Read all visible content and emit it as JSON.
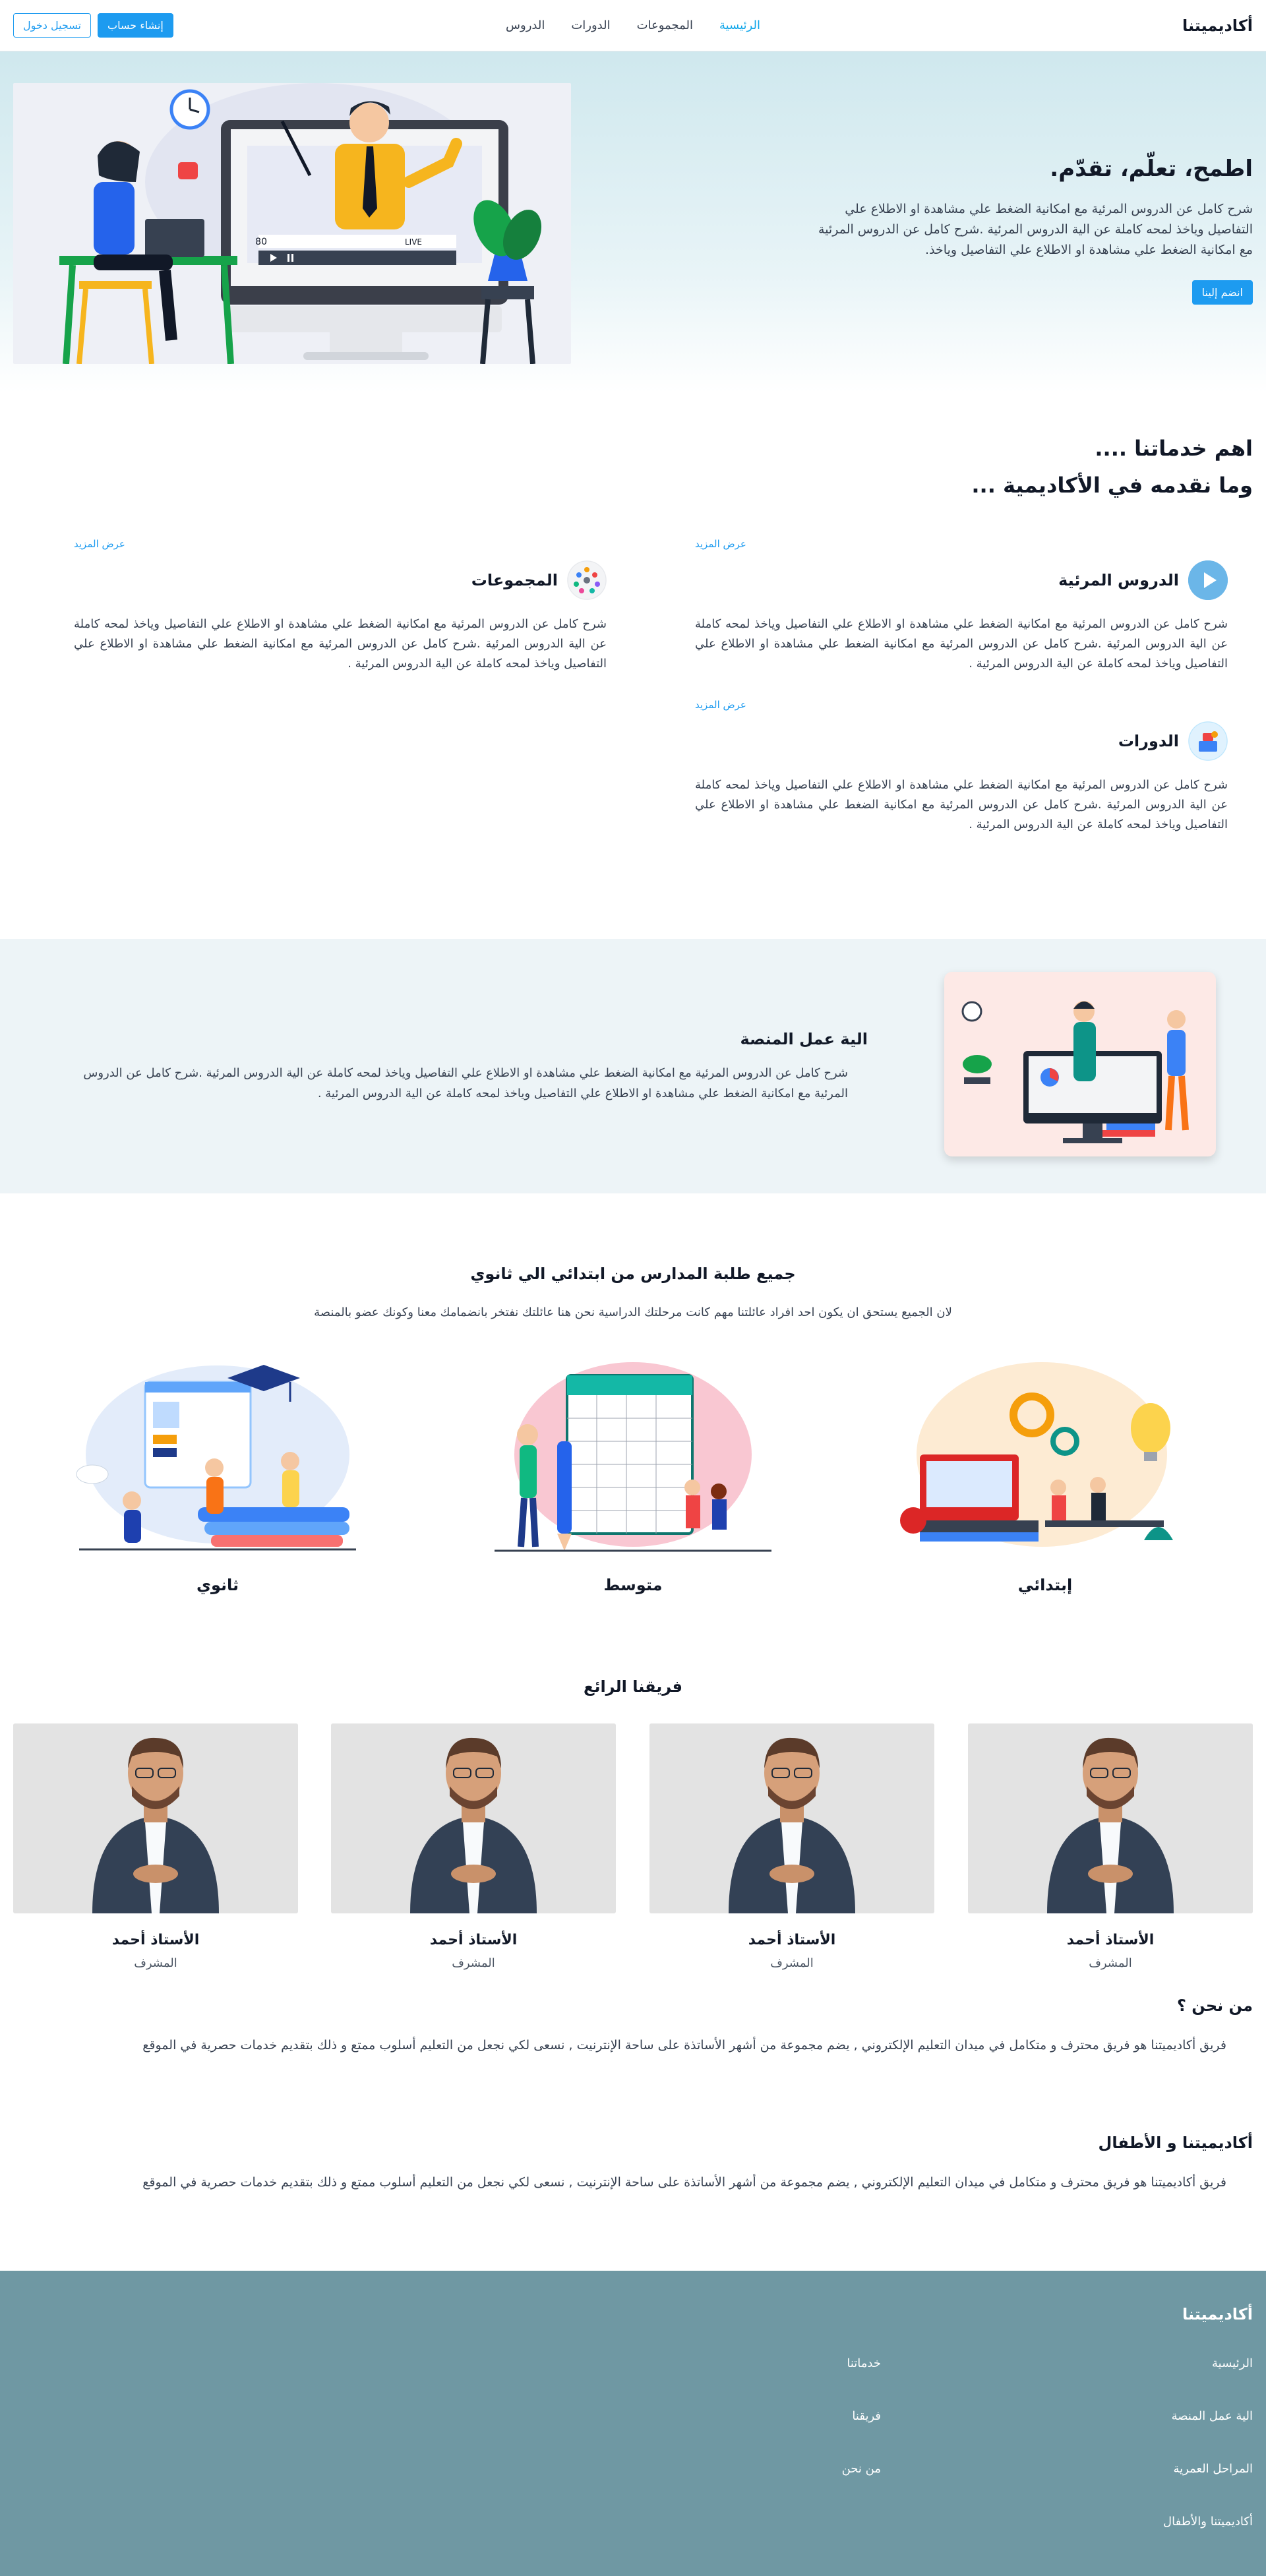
{
  "nav": {
    "brand": "أكاديميتنا",
    "links": [
      "الرئيسية",
      "المجموعات",
      "الدورات",
      "الدروس"
    ],
    "signup_label": "إنشاء حساب",
    "login_label": "تسجيل دخول"
  },
  "hero": {
    "title": "اطمح، تعلّم، تقدّم.",
    "description": "شرح كامل عن الدروس المرئية مع امكانية الضغط علي مشاهدة او الاطلاع علي التفاصيل وياخذ لمحه كاملة عن الية الدروس المرئية .شرح كامل عن الدروس المرئية مع امكانية الضغط علي مشاهدة او الاطلاع علي التفاصيل وياخذ.",
    "join_label": "انضم إلينا",
    "video_viewers": "80",
    "live_label": "LIVE"
  },
  "services": {
    "heading_line1": "اهم خدماتنا ....",
    "heading_line2": "وما نقدمه في الأكاديمية ...",
    "items": [
      {
        "title": "الدروس المرئية",
        "more": "عرض المزيد",
        "icon": "play-icon",
        "description": "شرح كامل عن الدروس المرئية مع امكانية الضغط علي مشاهدة او الاطلاع علي التفاصيل وياخذ لمحه كاملة عن الية الدروس المرئية .شرح كامل عن الدروس المرئية مع امكانية الضغط علي مشاهدة او الاطلاع علي التفاصيل وياخذ لمحه كاملة عن الية الدروس المرئية ."
      },
      {
        "title": "المجموعات",
        "more": "عرض المزيد",
        "icon": "group-icon",
        "description": "شرح كامل عن الدروس المرئية مع امكانية الضغط علي مشاهدة او الاطلاع علي التفاصيل وياخذ لمحه كاملة عن الية الدروس المرئية .شرح كامل عن الدروس المرئية مع امكانية الضغط علي مشاهدة او الاطلاع علي التفاصيل وياخذ لمحه كاملة عن الية الدروس المرئية ."
      },
      {
        "title": "الدورات",
        "more": "عرض المزيد",
        "icon": "courses-icon",
        "description": "شرح كامل عن الدروس المرئية مع امكانية الضغط علي مشاهدة او الاطلاع علي التفاصيل وياخذ لمحه كاملة عن الية الدروس المرئية .شرح كامل عن الدروس المرئية مع امكانية الضغط علي مشاهدة او الاطلاع علي التفاصيل وياخذ لمحه كاملة عن الية الدروس المرئية ."
      }
    ]
  },
  "platform": {
    "title": "الية عمل المنصة",
    "description": "شرح كامل عن الدروس المرئية مع امكانية الضغط علي مشاهدة او الاطلاع علي التفاصيل وياخذ لمحه كاملة عن الية الدروس المرئية .شرح كامل عن الدروس المرئية مع امكانية الضغط علي مشاهدة او الاطلاع علي التفاصيل وياخذ لمحه كاملة عن الية الدروس المرئية ."
  },
  "stages": {
    "title": "جميع طلبة المدارس من ابتدائي الي ثانوي",
    "subtitle": "لان الجميع يستحق ان يكون احد افراد عائلتنا مهم كانت مرحلتك الدراسية نحن هنا عائلتك نفتخر بانضمامك معنا وكونك عضو بالمنصة",
    "items": [
      "إبتدائي",
      "متوسط",
      "ثانوي"
    ]
  },
  "team": {
    "title": "فريقنا الرائع",
    "members": [
      {
        "name": "الأستاذ أحمد",
        "role": "المشرف"
      },
      {
        "name": "الأستاذ أحمد",
        "role": "المشرف"
      },
      {
        "name": "الأستاذ أحمد",
        "role": "المشرف"
      },
      {
        "name": "الأستاذ أحمد",
        "role": "المشرف"
      }
    ]
  },
  "about": {
    "who_title": "من نحن ؟",
    "who_desc": "فريق أكاديميتنا هو فريق محترف و متكامل في ميدان التعليم الإلكتروني , يضم مجموعة من أشهر الأساتذة على ساحة الإنترنيت , نسعى لكي نجعل من التعليم أسلوب ممتع و ذلك بتقديم خدمات حصرية في الموقع",
    "kids_title": "أكاديميتنا و الأطفال",
    "kids_desc": "فريق أكاديميتنا هو فريق محترف و متكامل في ميدان التعليم الإلكتروني , يضم مجموعة من أشهر الأساتذة على ساحة الإنترنيت , نسعى لكي نجعل من التعليم أسلوب ممتع و ذلك بتقديم خدمات حصرية في الموقع"
  },
  "footer": {
    "brand": "أكاديميتنا",
    "col1": [
      "الرئيسية",
      "الية عمل المنصة",
      "المراحل العمرية",
      "أكاديميتنا والأطفال"
    ],
    "col2": [
      "خدماتنا",
      "فريقنا",
      "من نحن"
    ]
  },
  "colors": {
    "accent": "#1d9bf0",
    "footer_bg": "#6f98a3",
    "hero_bg": "#cfe8ee",
    "platform_bg": "#edf4f7"
  }
}
